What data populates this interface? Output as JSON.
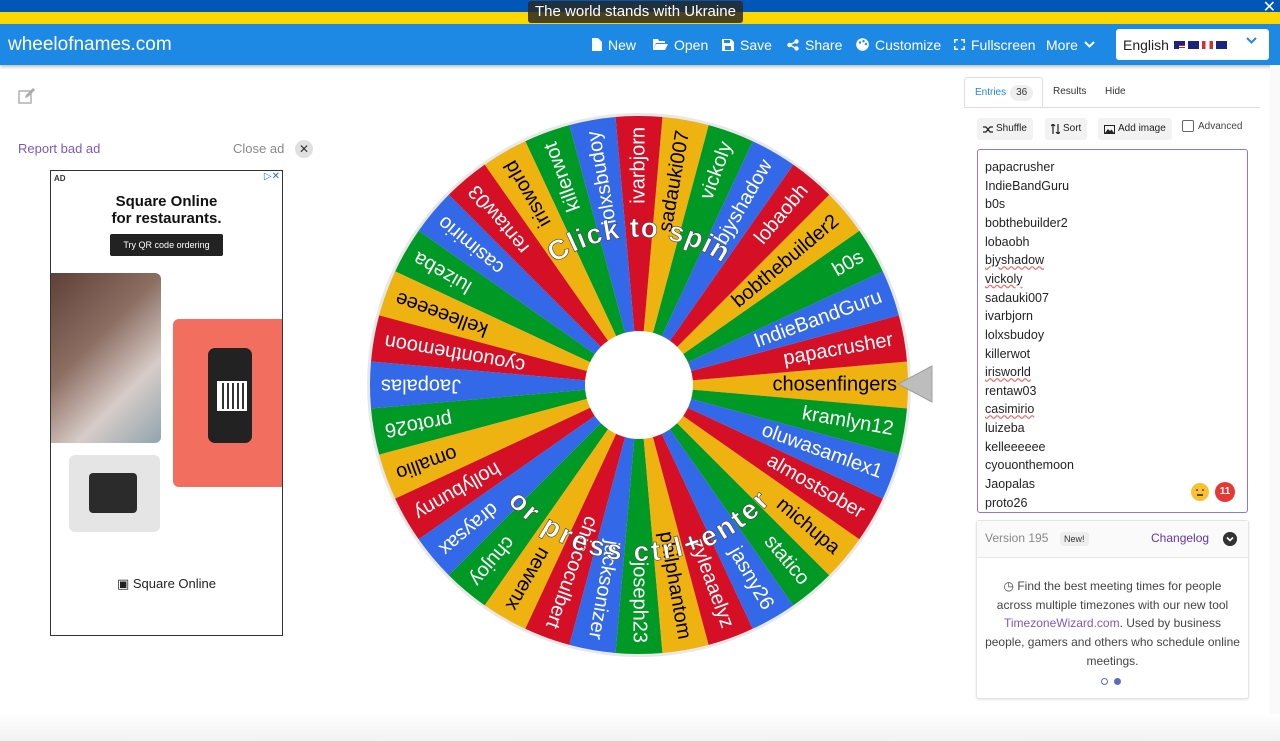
{
  "banner": {
    "message": "The world stands with Ukraine",
    "close": "✕"
  },
  "nav": {
    "brand": "wheelofnames.com",
    "items": [
      "New",
      "Open",
      "Save",
      "Share",
      "Customize",
      "Fullscreen",
      "More"
    ],
    "language": "English"
  },
  "ad": {
    "report": "Report bad ad",
    "close": "Close ad",
    "tag": "AD",
    "headline_1": "Square Online",
    "headline_2": "for restaurants.",
    "cta": "Try QR code ordering",
    "brand": "Square Online"
  },
  "wheel": {
    "prompt_top": "Click to spin",
    "prompt_bottom": "or press ctrl+enter",
    "colors": [
      "#3369e8",
      "#009925",
      "#eeb211",
      "#d50f25"
    ],
    "segments": [
      "chosenfingers",
      "papacrusher",
      "IndieBandGuru",
      "b0s",
      "bobthebuilder2",
      "lobaobh",
      "bjyshadow",
      "vickoly",
      "sadauki007",
      "ivarbjorn",
      "lolxsbudoy",
      "killerwot",
      "irisworld",
      "rentaw03",
      "casimirio",
      "luizeba",
      "kelleeeeee",
      "cyouonthemoon",
      "Jaopalas",
      "proto26",
      "omallio",
      "hollybunny",
      "draysax",
      "chujoy",
      "newenx",
      "chincoculbert",
      "jacksonizer",
      "joseph23",
      "philphantom",
      "zyleaaelyz",
      "jasny26",
      "statico",
      "michupa",
      "almostsober",
      "oluwasamlex1",
      "kramlyn12"
    ]
  },
  "panel": {
    "tabs": {
      "entries": "Entries",
      "entries_count": "36",
      "results": "Results",
      "hide": "Hide"
    },
    "tools": {
      "shuffle": "Shuffle",
      "sort": "Sort",
      "add_image": "Add image",
      "advanced": "Advanced"
    },
    "entries": [
      "papacrusher",
      "IndieBandGuru",
      "b0s",
      "bobthebuilder2",
      "lobaobh",
      "bjyshadow",
      "vickoly",
      "sadauki007",
      "ivarbjorn",
      "lolxsbudoy",
      "killerwot",
      "irisworld",
      "rentaw03",
      "casimirio",
      "luizeba",
      "kelleeeeee",
      "cyouonthemoon",
      "Jaopalas",
      "proto26"
    ],
    "error_count": "11"
  },
  "info": {
    "version": "Version 195",
    "new": "New!",
    "changelog": "Changelog",
    "text_1": "Find the best meeting times for people across multiple timezones with our new tool",
    "link": "TimezoneWizard.com",
    "text_2": ". Used by business people, gamers and others who schedule online meetings."
  }
}
